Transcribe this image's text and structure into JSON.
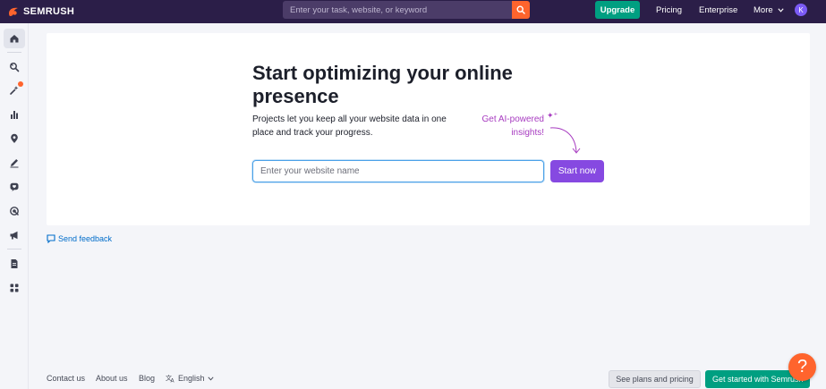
{
  "topbar": {
    "brand": "SEMRUSH",
    "search_placeholder": "Enter your task, website, or keyword",
    "upgrade_label": "Upgrade",
    "nav": {
      "pricing": "Pricing",
      "enterprise": "Enterprise",
      "more": "More"
    },
    "avatar_initial": "K"
  },
  "sidebar": {
    "items": [
      {
        "icon": "home-icon",
        "active": true
      },
      {
        "icon": "seo-icon",
        "active": false
      },
      {
        "icon": "ai-sparkle-icon",
        "active": false,
        "badge": true
      },
      {
        "icon": "chart-icon",
        "active": false
      },
      {
        "icon": "location-pin-icon",
        "active": false
      },
      {
        "icon": "content-pen-icon",
        "active": false
      },
      {
        "icon": "social-heart-icon",
        "active": false
      },
      {
        "icon": "target-icon",
        "active": false
      },
      {
        "icon": "megaphone-icon",
        "active": false
      },
      {
        "icon": "document-icon",
        "active": false
      },
      {
        "icon": "apps-grid-icon",
        "active": false
      }
    ]
  },
  "main": {
    "headline": "Start optimizing your online presence",
    "subtext": "Projects let you keep all your website data in one place and track your progress.",
    "ai_note": "Get AI-powered insights!",
    "website_placeholder": "Enter your website name",
    "start_label": "Start now"
  },
  "feedback_label": "Send feedback",
  "footer": {
    "contact": "Contact us",
    "about": "About us",
    "blog": "Blog",
    "language": "English",
    "plans_label": "See plans and pricing",
    "get_started_label": "Get started with Semrush"
  },
  "help_label": "?",
  "colors": {
    "topbar": "#2b1e48",
    "accent_orange": "#ff642d",
    "green": "#009f81",
    "purple_button": "#8649e1",
    "ai_magenta": "#a73bc0",
    "link_blue": "#006dca"
  }
}
